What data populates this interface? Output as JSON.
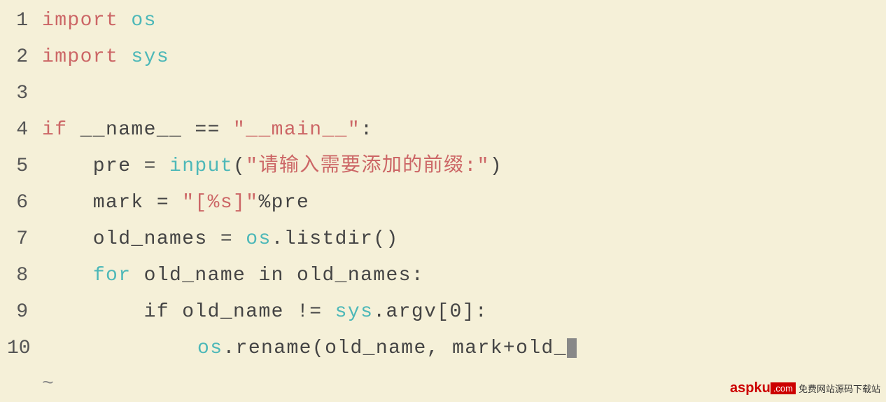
{
  "background": "#f5f0d8",
  "lines": [
    {
      "number": "1",
      "tokens": [
        {
          "text": "import",
          "class": "kw-import"
        },
        {
          "text": " "
        },
        {
          "text": "os",
          "class": "kw-module"
        }
      ]
    },
    {
      "number": "2",
      "tokens": [
        {
          "text": "import",
          "class": "kw-import"
        },
        {
          "text": " "
        },
        {
          "text": "sys",
          "class": "kw-module"
        }
      ]
    },
    {
      "number": "3",
      "tokens": []
    },
    {
      "number": "4",
      "tokens": [
        {
          "text": "if",
          "class": "kw-if"
        },
        {
          "text": " __name__ == "
        },
        {
          "text": "\"__main__\"",
          "class": "kw-string"
        },
        {
          "text": ":"
        }
      ]
    },
    {
      "number": "5",
      "tokens": [
        {
          "text": "    pre = "
        },
        {
          "text": "input",
          "class": "kw-input"
        },
        {
          "text": "("
        },
        {
          "text": "\"请输入需要添加的前缀:\"",
          "class": "kw-chinese"
        },
        {
          "text": ")"
        }
      ]
    },
    {
      "number": "6",
      "tokens": [
        {
          "text": "    mark = "
        },
        {
          "text": "\"[%s]\"",
          "class": "kw-string"
        },
        {
          "text": "%pre"
        }
      ]
    },
    {
      "number": "7",
      "tokens": [
        {
          "text": "    old_names = "
        },
        {
          "text": "os",
          "class": "kw-os"
        },
        {
          "text": ".listdir()"
        }
      ]
    },
    {
      "number": "8",
      "tokens": [
        {
          "text": "    "
        },
        {
          "text": "for",
          "class": "kw-for"
        },
        {
          "text": " old_name in old_names:"
        }
      ]
    },
    {
      "number": "9",
      "tokens": [
        {
          "text": "        if old_name != "
        },
        {
          "text": "sys",
          "class": "kw-sys"
        },
        {
          "text": ".argv[0]:"
        }
      ]
    },
    {
      "number": "10",
      "tokens": [
        {
          "text": "            "
        },
        {
          "text": "os",
          "class": "kw-os"
        },
        {
          "text": ".rename(old_name, mark+old_",
          "cursor": true
        }
      ]
    }
  ],
  "tilde": "~",
  "watermark": {
    "aspku": "aspku",
    "com": ".com",
    "subtitle": "免费网站源码下载站",
    "box_text": ".com"
  }
}
